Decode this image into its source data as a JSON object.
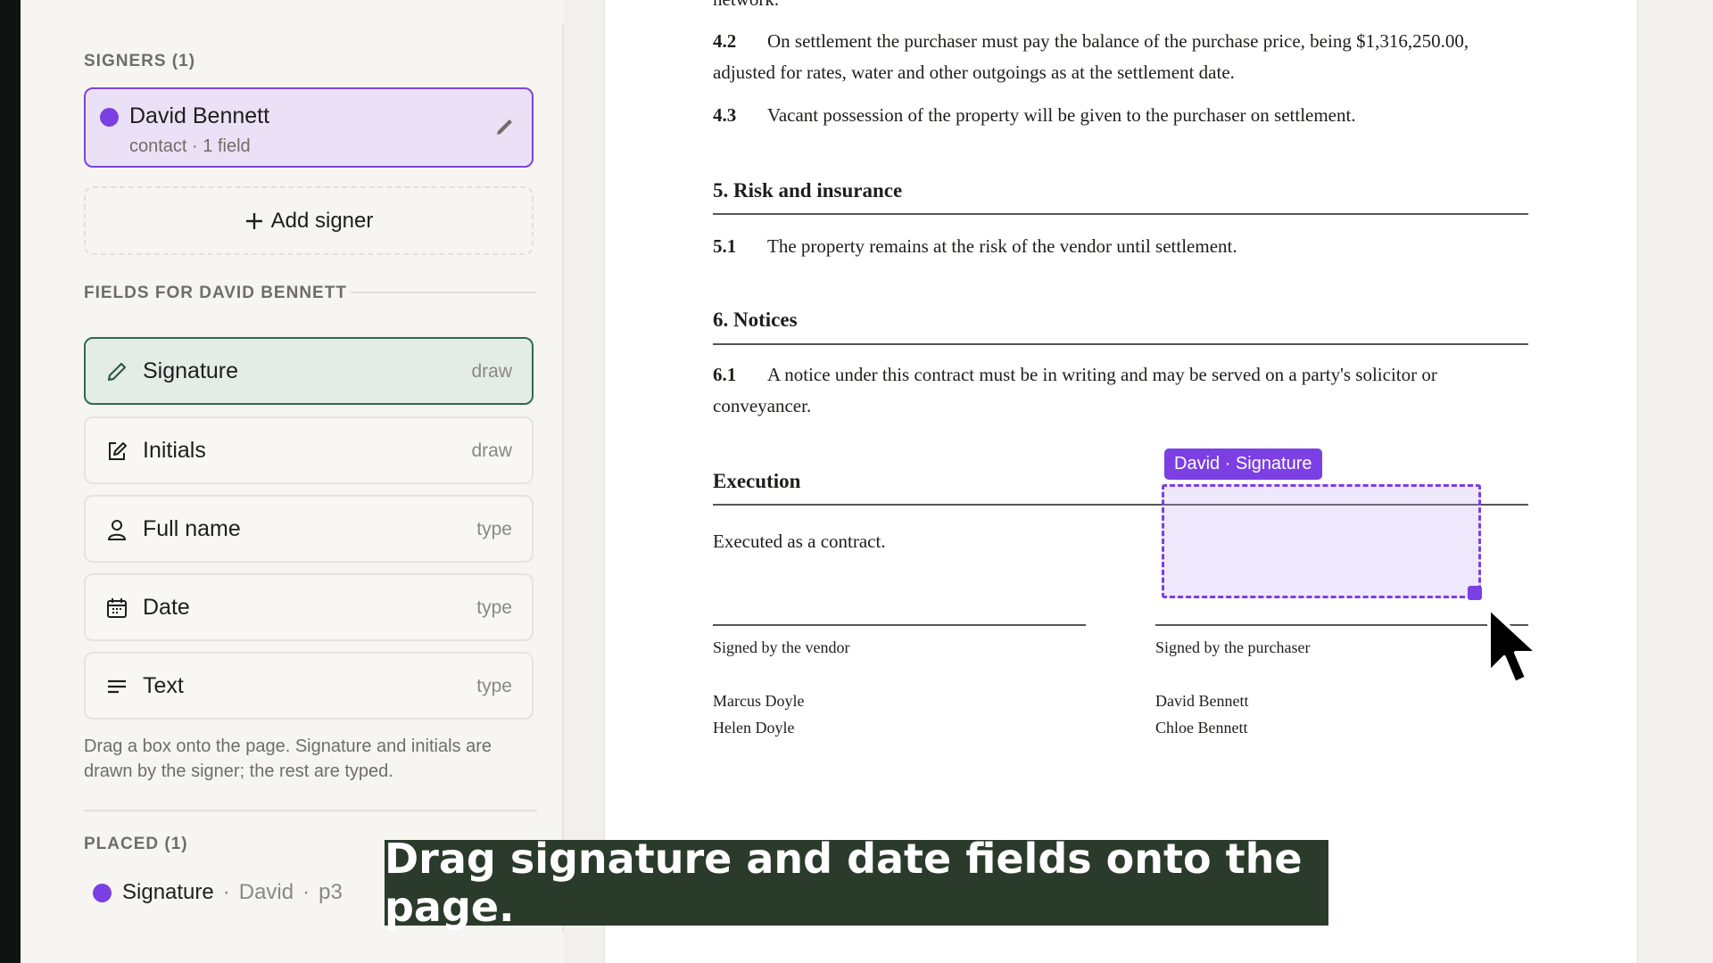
{
  "sidebar": {
    "signers_label": "SIGNERS (1)",
    "signer": {
      "name": "David Bennett",
      "role": "contact",
      "fields_count": "1 field",
      "color": "#7b3fe4"
    },
    "add_signer_label": "Add signer",
    "fields_label": "FIELDS FOR DAVID BENNETT",
    "fields": [
      {
        "label": "Signature",
        "kind": "draw",
        "icon": "pen-icon",
        "active": true
      },
      {
        "label": "Initials",
        "kind": "draw",
        "icon": "edit-icon",
        "active": false
      },
      {
        "label": "Full name",
        "kind": "type",
        "icon": "person-icon",
        "active": false
      },
      {
        "label": "Date",
        "kind": "type",
        "icon": "calendar-icon",
        "active": false
      },
      {
        "label": "Text",
        "kind": "type",
        "icon": "text-lines-icon",
        "active": false
      }
    ],
    "help_text": "Drag a box onto the page. Signature and initials are drawn by the signer; the rest are typed.",
    "placed_label": "PLACED (1)",
    "placed": [
      {
        "field": "Signature",
        "signer": "David",
        "page": "p3"
      }
    ]
  },
  "document": {
    "top_fragment": "network.",
    "clauses": [
      {
        "num": "4.2",
        "text": "On settlement the purchaser must pay the balance of the purchase price, being $1,316,250.00,",
        "cont": "adjusted for rates, water and other outgoings as at the settlement date."
      },
      {
        "num": "4.3",
        "text": "Vacant possession of the property will be given to the purchaser on settlement."
      },
      {
        "num": "5.1",
        "text": "The property remains at the risk of the vendor until settlement."
      },
      {
        "num": "6.1",
        "text": "A notice under this contract must be in writing and may be served on a party's solicitor or",
        "cont": "conveyancer."
      }
    ],
    "headings": {
      "risk": "5. Risk and insurance",
      "notices": "6. Notices",
      "execution": "Execution"
    },
    "executed_text": "Executed as a contract.",
    "vendor": {
      "label": "Signed by the vendor",
      "names": [
        "Marcus Doyle",
        "Helen Doyle"
      ]
    },
    "purchaser": {
      "label": "Signed by the purchaser",
      "names": [
        "David Bennett",
        "Chloe Bennett"
      ]
    },
    "placed_field_tag": "David · Signature"
  },
  "caption": "Drag signature and date fields onto the page.",
  "colors": {
    "accent": "#7b3fe4",
    "active_field": "#2e6a52",
    "caption_bg": "#2b3b2b"
  }
}
